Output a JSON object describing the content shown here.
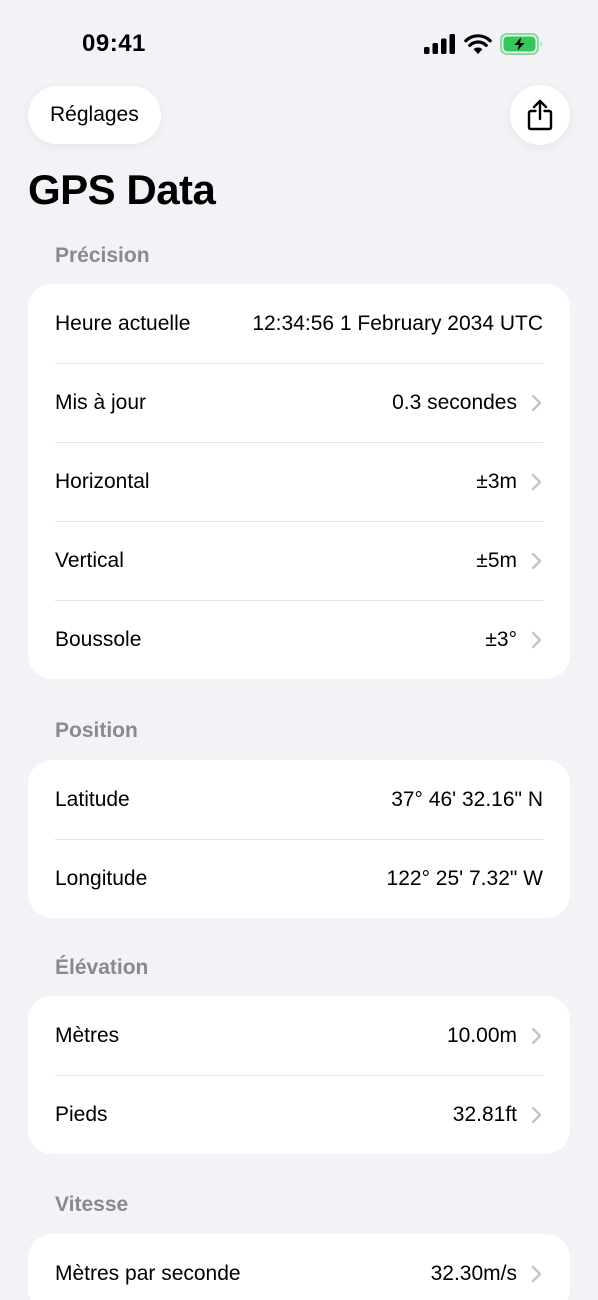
{
  "status_bar": {
    "time": "09:41"
  },
  "nav": {
    "back_label": "Réglages",
    "title": "GPS Data"
  },
  "sections": {
    "precision": {
      "header": "Précision",
      "rows": [
        {
          "label": "Heure actuelle",
          "value": "12:34:56 1 February 2034 UTC"
        },
        {
          "label": "Mis à jour",
          "value": "0.3 secondes"
        },
        {
          "label": "Horizontal",
          "value": "±3m"
        },
        {
          "label": "Vertical",
          "value": "±5m"
        },
        {
          "label": "Boussole",
          "value": "±3°"
        }
      ]
    },
    "position": {
      "header": "Position",
      "rows": [
        {
          "label": "Latitude",
          "value": "37° 46' 32.16\" N"
        },
        {
          "label": "Longitude",
          "value": "122° 25' 7.32\" W"
        }
      ]
    },
    "elevation": {
      "header": "Élévation",
      "rows": [
        {
          "label": "Mètres",
          "value": "10.00m"
        },
        {
          "label": "Pieds",
          "value": "32.81ft"
        }
      ]
    },
    "speed": {
      "header": "Vitesse",
      "rows": [
        {
          "label": "Mètres par seconde",
          "value": "32.30m/s"
        }
      ]
    }
  },
  "colors": {
    "background": "#f2f2f7",
    "card": "#ffffff",
    "secondary_text": "#8a8a8e",
    "chevron": "#c4c4c7",
    "battery_green": "#34c759"
  },
  "icons": [
    "cellular-signal-icon",
    "wifi-icon",
    "battery-charging-icon",
    "share-icon",
    "chevron-right-icon"
  ]
}
